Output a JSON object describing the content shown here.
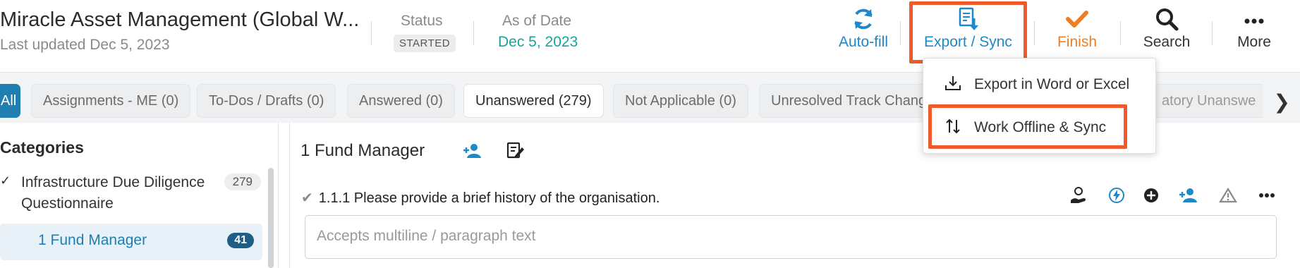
{
  "header": {
    "title": "Miracle Asset Management (Global W...",
    "last_updated": "Last updated Dec 5, 2023",
    "status_label": "Status",
    "status_value": "STARTED",
    "as_of_label": "As of Date",
    "as_of_value": "Dec 5, 2023"
  },
  "toolbar": {
    "autofill_label": "Auto-fill",
    "export_sync_label": "Export / Sync",
    "finish_label": "Finish",
    "search_label": "Search",
    "more_label": "More"
  },
  "dropdown": {
    "items": [
      {
        "label": "Export in Word or Excel",
        "icon": "download-icon"
      },
      {
        "label": "Work Offline & Sync",
        "icon": "sort-arrows-icon"
      }
    ]
  },
  "tabs": [
    {
      "label": "All"
    },
    {
      "label": "Assignments - ME (0)"
    },
    {
      "label": "To-Dos / Drafts (0)"
    },
    {
      "label": "Answered (0)"
    },
    {
      "label": "Unanswered (279)"
    },
    {
      "label": "Not Applicable (0)"
    },
    {
      "label": "Unresolved Track Chang"
    },
    {
      "label": "atory Unanswe"
    }
  ],
  "sidebar": {
    "title": "Categories",
    "items": [
      {
        "label": "Infrastructure Due Diligence Questionnaire",
        "count": "279"
      },
      {
        "label": "1 Fund Manager",
        "count": "41"
      }
    ]
  },
  "main": {
    "section_title": "1 Fund Manager",
    "question": "1.1.1 Please provide a brief history of the organisation.",
    "answer_placeholder": "Accepts multiline / paragraph text"
  },
  "colors": {
    "accent_blue": "#1e88c8",
    "finish_orange": "#ef7d22",
    "highlight_red": "#ef5a2a",
    "date_teal": "#1aa39a"
  }
}
